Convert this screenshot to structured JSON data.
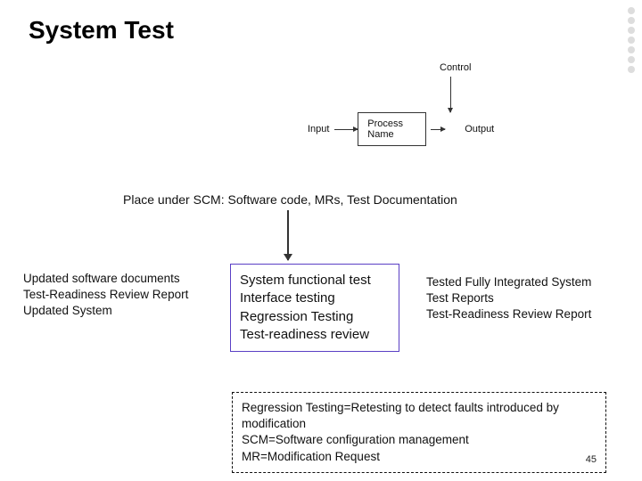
{
  "title": "System Test",
  "legend": {
    "control": "Control",
    "input": "Input",
    "process": "Process Name",
    "output": "Output"
  },
  "scm_text": "Place under SCM: Software code, MRs,  Test Documentation",
  "inputs": [
    "Updated software  documents",
    "Test-Readiness Review Report",
    "Updated System"
  ],
  "center": [
    "System functional test",
    "Interface testing",
    "Regression Testing",
    "Test-readiness review"
  ],
  "outputs": [
    "Tested Fully Integrated System",
    "Test Reports",
    "Test-Readiness Review Report"
  ],
  "glossary": [
    "Regression Testing=Retesting to detect faults introduced by modification",
    "SCM=Software configuration management",
    "MR=Modification Request"
  ],
  "page_number": "45",
  "chart_data": {
    "type": "diagram",
    "title": "System Test",
    "process": "System Test",
    "control": "Place under SCM: Software code, MRs, Test Documentation",
    "inputs": [
      "Updated software documents",
      "Test-Readiness Review Report",
      "Updated System"
    ],
    "activities": [
      "System functional test",
      "Interface testing",
      "Regression Testing",
      "Test-readiness review"
    ],
    "outputs": [
      "Tested Fully Integrated System",
      "Test Reports",
      "Test-Readiness Review Report"
    ],
    "legend_template": {
      "control": "Control",
      "input": "Input",
      "process_box": "Process Name",
      "output": "Output"
    },
    "definitions": {
      "Regression Testing": "Retesting to detect faults introduced by modification",
      "SCM": "Software configuration management",
      "MR": "Modification Request"
    }
  }
}
